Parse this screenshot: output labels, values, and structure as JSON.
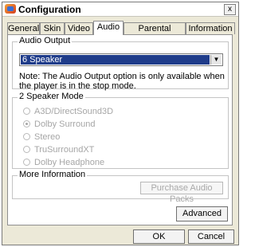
{
  "window": {
    "title": "Configuration",
    "close_glyph": "x"
  },
  "tabs": [
    {
      "label": "General"
    },
    {
      "label": "Skin"
    },
    {
      "label": "Video"
    },
    {
      "label": "Audio",
      "active": true
    },
    {
      "label": "Parental Control"
    },
    {
      "label": "Information"
    }
  ],
  "audio_output": {
    "group_label": "Audio Output",
    "selected": "6 Speaker",
    "note": "Note:  The Audio Output option is only available when the player is in the stop mode."
  },
  "speaker_mode": {
    "group_label": "2 Speaker Mode",
    "options": [
      {
        "label": "A3D/DirectSound3D",
        "checked": false
      },
      {
        "label": "Dolby Surround",
        "checked": true
      },
      {
        "label": "Stereo",
        "checked": false
      },
      {
        "label": "TruSurroundXT",
        "checked": false
      },
      {
        "label": "Dolby Headphone",
        "checked": false
      }
    ]
  },
  "more_info": {
    "group_label": "More Information",
    "purchase_label": "Purchase Audio Packs"
  },
  "buttons": {
    "advanced": "Advanced",
    "ok": "OK",
    "cancel": "Cancel"
  }
}
